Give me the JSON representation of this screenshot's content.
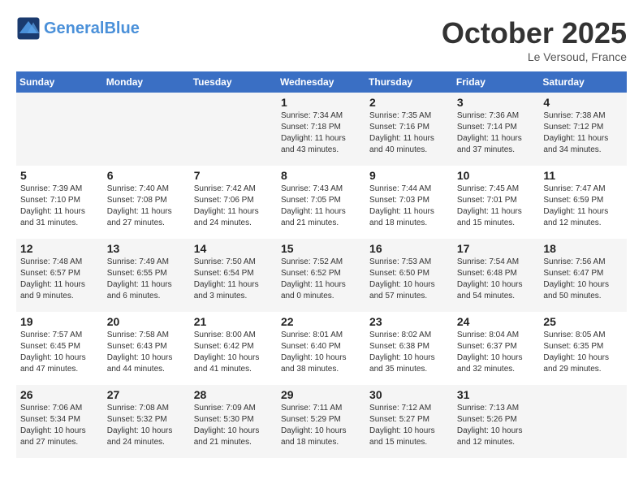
{
  "header": {
    "logo_line1": "General",
    "logo_line2": "Blue",
    "month": "October 2025",
    "location": "Le Versoud, France"
  },
  "weekdays": [
    "Sunday",
    "Monday",
    "Tuesday",
    "Wednesday",
    "Thursday",
    "Friday",
    "Saturday"
  ],
  "weeks": [
    [
      {
        "day": "",
        "info": ""
      },
      {
        "day": "",
        "info": ""
      },
      {
        "day": "",
        "info": ""
      },
      {
        "day": "1",
        "info": "Sunrise: 7:34 AM\nSunset: 7:18 PM\nDaylight: 11 hours\nand 43 minutes."
      },
      {
        "day": "2",
        "info": "Sunrise: 7:35 AM\nSunset: 7:16 PM\nDaylight: 11 hours\nand 40 minutes."
      },
      {
        "day": "3",
        "info": "Sunrise: 7:36 AM\nSunset: 7:14 PM\nDaylight: 11 hours\nand 37 minutes."
      },
      {
        "day": "4",
        "info": "Sunrise: 7:38 AM\nSunset: 7:12 PM\nDaylight: 11 hours\nand 34 minutes."
      }
    ],
    [
      {
        "day": "5",
        "info": "Sunrise: 7:39 AM\nSunset: 7:10 PM\nDaylight: 11 hours\nand 31 minutes."
      },
      {
        "day": "6",
        "info": "Sunrise: 7:40 AM\nSunset: 7:08 PM\nDaylight: 11 hours\nand 27 minutes."
      },
      {
        "day": "7",
        "info": "Sunrise: 7:42 AM\nSunset: 7:06 PM\nDaylight: 11 hours\nand 24 minutes."
      },
      {
        "day": "8",
        "info": "Sunrise: 7:43 AM\nSunset: 7:05 PM\nDaylight: 11 hours\nand 21 minutes."
      },
      {
        "day": "9",
        "info": "Sunrise: 7:44 AM\nSunset: 7:03 PM\nDaylight: 11 hours\nand 18 minutes."
      },
      {
        "day": "10",
        "info": "Sunrise: 7:45 AM\nSunset: 7:01 PM\nDaylight: 11 hours\nand 15 minutes."
      },
      {
        "day": "11",
        "info": "Sunrise: 7:47 AM\nSunset: 6:59 PM\nDaylight: 11 hours\nand 12 minutes."
      }
    ],
    [
      {
        "day": "12",
        "info": "Sunrise: 7:48 AM\nSunset: 6:57 PM\nDaylight: 11 hours\nand 9 minutes."
      },
      {
        "day": "13",
        "info": "Sunrise: 7:49 AM\nSunset: 6:55 PM\nDaylight: 11 hours\nand 6 minutes."
      },
      {
        "day": "14",
        "info": "Sunrise: 7:50 AM\nSunset: 6:54 PM\nDaylight: 11 hours\nand 3 minutes."
      },
      {
        "day": "15",
        "info": "Sunrise: 7:52 AM\nSunset: 6:52 PM\nDaylight: 11 hours\nand 0 minutes."
      },
      {
        "day": "16",
        "info": "Sunrise: 7:53 AM\nSunset: 6:50 PM\nDaylight: 10 hours\nand 57 minutes."
      },
      {
        "day": "17",
        "info": "Sunrise: 7:54 AM\nSunset: 6:48 PM\nDaylight: 10 hours\nand 54 minutes."
      },
      {
        "day": "18",
        "info": "Sunrise: 7:56 AM\nSunset: 6:47 PM\nDaylight: 10 hours\nand 50 minutes."
      }
    ],
    [
      {
        "day": "19",
        "info": "Sunrise: 7:57 AM\nSunset: 6:45 PM\nDaylight: 10 hours\nand 47 minutes."
      },
      {
        "day": "20",
        "info": "Sunrise: 7:58 AM\nSunset: 6:43 PM\nDaylight: 10 hours\nand 44 minutes."
      },
      {
        "day": "21",
        "info": "Sunrise: 8:00 AM\nSunset: 6:42 PM\nDaylight: 10 hours\nand 41 minutes."
      },
      {
        "day": "22",
        "info": "Sunrise: 8:01 AM\nSunset: 6:40 PM\nDaylight: 10 hours\nand 38 minutes."
      },
      {
        "day": "23",
        "info": "Sunrise: 8:02 AM\nSunset: 6:38 PM\nDaylight: 10 hours\nand 35 minutes."
      },
      {
        "day": "24",
        "info": "Sunrise: 8:04 AM\nSunset: 6:37 PM\nDaylight: 10 hours\nand 32 minutes."
      },
      {
        "day": "25",
        "info": "Sunrise: 8:05 AM\nSunset: 6:35 PM\nDaylight: 10 hours\nand 29 minutes."
      }
    ],
    [
      {
        "day": "26",
        "info": "Sunrise: 7:06 AM\nSunset: 5:34 PM\nDaylight: 10 hours\nand 27 minutes."
      },
      {
        "day": "27",
        "info": "Sunrise: 7:08 AM\nSunset: 5:32 PM\nDaylight: 10 hours\nand 24 minutes."
      },
      {
        "day": "28",
        "info": "Sunrise: 7:09 AM\nSunset: 5:30 PM\nDaylight: 10 hours\nand 21 minutes."
      },
      {
        "day": "29",
        "info": "Sunrise: 7:11 AM\nSunset: 5:29 PM\nDaylight: 10 hours\nand 18 minutes."
      },
      {
        "day": "30",
        "info": "Sunrise: 7:12 AM\nSunset: 5:27 PM\nDaylight: 10 hours\nand 15 minutes."
      },
      {
        "day": "31",
        "info": "Sunrise: 7:13 AM\nSunset: 5:26 PM\nDaylight: 10 hours\nand 12 minutes."
      },
      {
        "day": "",
        "info": ""
      }
    ]
  ]
}
